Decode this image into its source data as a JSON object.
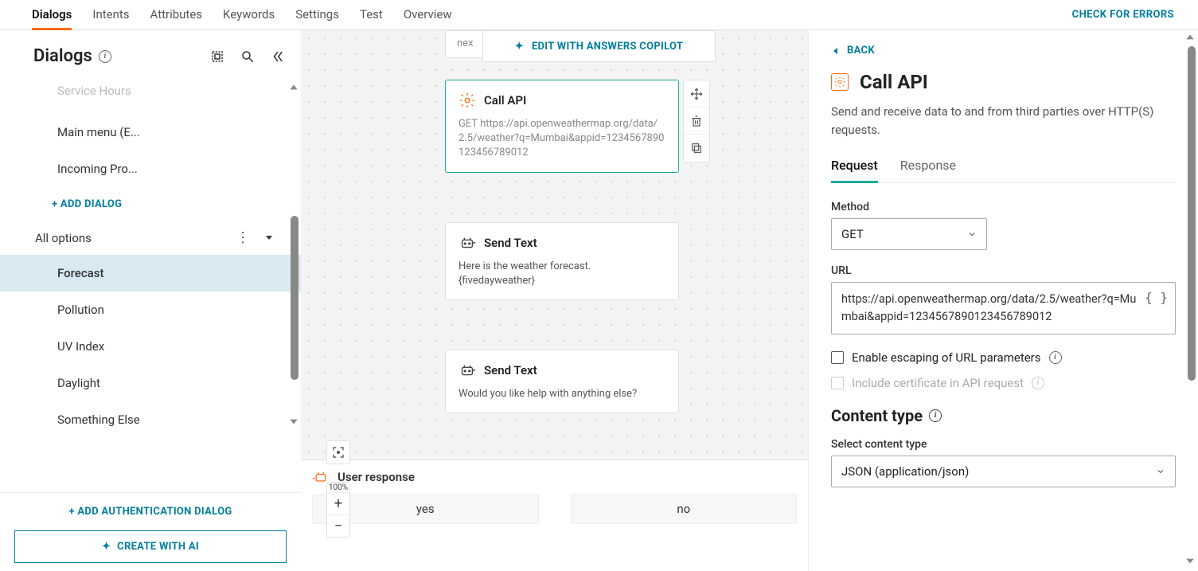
{
  "topnav": {
    "tabs": [
      "Dialogs",
      "Intents",
      "Attributes",
      "Keywords",
      "Settings",
      "Test",
      "Overview"
    ],
    "active": "Dialogs",
    "check_errors": "CHECK FOR ERRORS"
  },
  "sidebar": {
    "title": "Dialogs",
    "items_top": [
      {
        "label": "Service Hours"
      },
      {
        "label": "Main menu (E..."
      },
      {
        "label": "Incoming Pro..."
      }
    ],
    "add_dialog": "+ ADD DIALOG",
    "section": {
      "label": "All options",
      "items": [
        {
          "label": "Forecast",
          "selected": true
        },
        {
          "label": "Pollution"
        },
        {
          "label": "UV Index"
        },
        {
          "label": "Daylight"
        },
        {
          "label": "Something Else"
        }
      ]
    },
    "add_auth": "+ ADD AUTHENTICATION DIALOG",
    "create_ai": "CREATE WITH AI"
  },
  "canvas": {
    "truncated": "nex",
    "copilot": "EDIT WITH ANSWERS COPILOT",
    "nodes": [
      {
        "kind": "call-api",
        "title": "Call API",
        "body": "GET https://api.openweathermap.org/data/2.5/weather?q=Mumbai&appid=1234567890123456789012",
        "selected": true
      },
      {
        "kind": "send-text",
        "title": "Send Text",
        "body": "Here is the weather forecast. {fivedayweather}"
      },
      {
        "kind": "send-text",
        "title": "Send Text",
        "body": "Would you like help with anything else?"
      }
    ],
    "user_response": {
      "label": "User response",
      "options": [
        "yes",
        "no"
      ]
    },
    "zoom": "100%"
  },
  "rpanel": {
    "back": "BACK",
    "title": "Call API",
    "desc": "Send and receive data to and from third parties over HTTP(S) requests.",
    "tabs": [
      "Request",
      "Response"
    ],
    "active_tab": "Request",
    "method_label": "Method",
    "method_value": "GET",
    "url_label": "URL",
    "url_value": "https://api.openweathermap.org/data/2.5/weather?q=Mumbai&appid=1234567890123456789012",
    "escape_label": "Enable escaping of URL parameters",
    "cert_label": "Include certificate in API request",
    "content_type_title": "Content type",
    "content_type_label": "Select content type",
    "content_type_value": "JSON (application/json)"
  }
}
